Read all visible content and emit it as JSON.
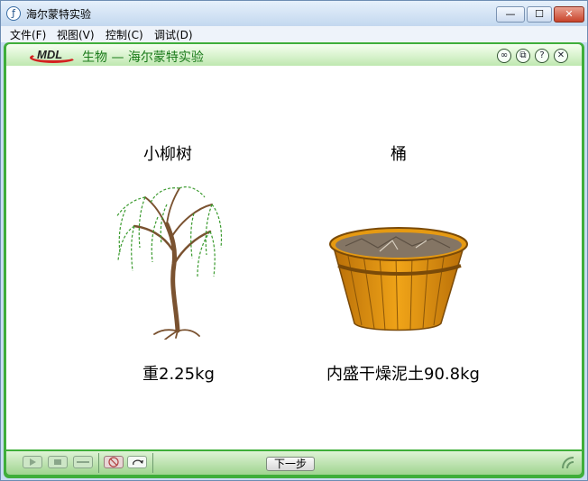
{
  "window": {
    "title": "海尔蒙特实验"
  },
  "menu": [
    "文件(F)",
    "视图(V)",
    "控制(C)",
    "调试(D)"
  ],
  "app": {
    "logo": "MDL",
    "title": "生物 — 海尔蒙特实验"
  },
  "scene": {
    "willow_title": "小柳树",
    "willow_weight": "重2.25kg",
    "bucket_title": "桶",
    "bucket_content": "内盛干燥泥土90.8kg"
  },
  "controls": {
    "next_label": "下一步"
  },
  "colors": {
    "frame_green": "#3fae3a",
    "title_green": "#1a7a1a",
    "bucket_orange": "#d98a10"
  }
}
